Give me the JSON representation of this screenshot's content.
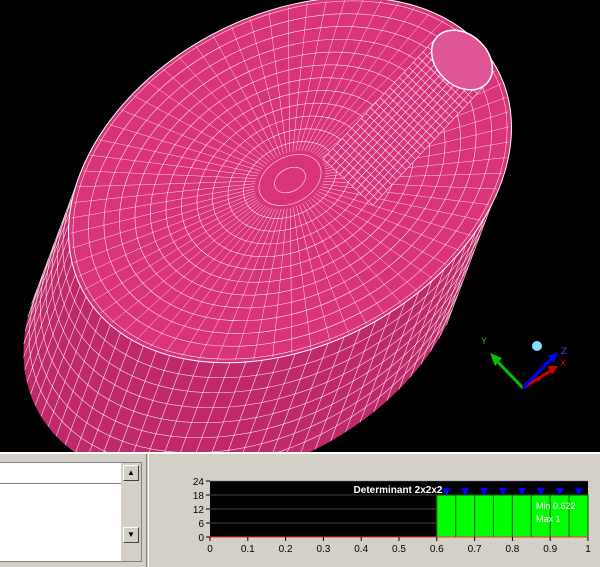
{
  "viewport": {
    "background": "#000000",
    "mesh_color": "#d9337a",
    "mesh_line_color": "#ffffff",
    "triad": {
      "x_label": "X",
      "y_label": "Y",
      "z_label": "Z"
    }
  },
  "log_panel": {
    "lines": [
      ""
    ]
  },
  "histogram": {
    "title": "Determinant 2x2x2",
    "min_label": "Min 0.622",
    "max_label": "Max 1",
    "y_ticks": [
      "24",
      "18",
      "12",
      "6",
      "0"
    ],
    "x_ticks": [
      "0",
      "0.1",
      "0.2",
      "0.3",
      "0.4",
      "0.5",
      "0.6",
      "0.7",
      "0.8",
      "0.9",
      "1"
    ],
    "bar_color": "#00ff00",
    "marker_color": "#0000ff",
    "chart_data": {
      "type": "bar",
      "categories": [
        "0.6",
        "0.65",
        "0.7",
        "0.75",
        "0.8",
        "0.85",
        "0.9",
        "0.95"
      ],
      "values": [
        18,
        18,
        18,
        18,
        18,
        18,
        18,
        18
      ],
      "ylim": [
        0,
        24
      ],
      "xlim": [
        0,
        1
      ]
    }
  }
}
